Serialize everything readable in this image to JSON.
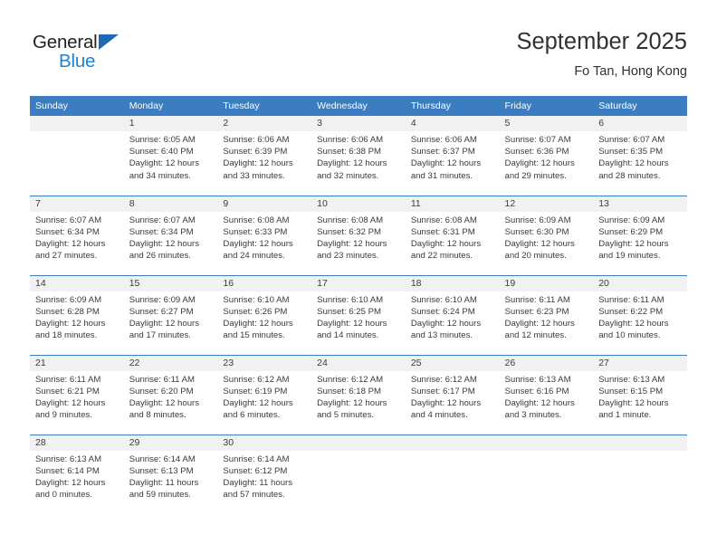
{
  "brand": {
    "name_top": "General",
    "name_bottom": "Blue",
    "triangle_color": "#1c6ab3",
    "text_color": "#1e81d1"
  },
  "header": {
    "title": "September 2025",
    "subtitle": "Fo Tan, Hong Kong"
  },
  "theme": {
    "header_blue": "#3b7dc0",
    "daynum_bg": "#f1f1f1",
    "text": "#3b3b3b"
  },
  "calendar": {
    "weekday_headers": [
      "Sunday",
      "Monday",
      "Tuesday",
      "Wednesday",
      "Thursday",
      "Friday",
      "Saturday"
    ],
    "weeks": [
      [
        {
          "day": "",
          "sunrise": "",
          "sunset": "",
          "daylight": ""
        },
        {
          "day": "1",
          "sunrise": "Sunrise: 6:05 AM",
          "sunset": "Sunset: 6:40 PM",
          "daylight": "Daylight: 12 hours and 34 minutes."
        },
        {
          "day": "2",
          "sunrise": "Sunrise: 6:06 AM",
          "sunset": "Sunset: 6:39 PM",
          "daylight": "Daylight: 12 hours and 33 minutes."
        },
        {
          "day": "3",
          "sunrise": "Sunrise: 6:06 AM",
          "sunset": "Sunset: 6:38 PM",
          "daylight": "Daylight: 12 hours and 32 minutes."
        },
        {
          "day": "4",
          "sunrise": "Sunrise: 6:06 AM",
          "sunset": "Sunset: 6:37 PM",
          "daylight": "Daylight: 12 hours and 31 minutes."
        },
        {
          "day": "5",
          "sunrise": "Sunrise: 6:07 AM",
          "sunset": "Sunset: 6:36 PM",
          "daylight": "Daylight: 12 hours and 29 minutes."
        },
        {
          "day": "6",
          "sunrise": "Sunrise: 6:07 AM",
          "sunset": "Sunset: 6:35 PM",
          "daylight": "Daylight: 12 hours and 28 minutes."
        }
      ],
      [
        {
          "day": "7",
          "sunrise": "Sunrise: 6:07 AM",
          "sunset": "Sunset: 6:34 PM",
          "daylight": "Daylight: 12 hours and 27 minutes."
        },
        {
          "day": "8",
          "sunrise": "Sunrise: 6:07 AM",
          "sunset": "Sunset: 6:34 PM",
          "daylight": "Daylight: 12 hours and 26 minutes."
        },
        {
          "day": "9",
          "sunrise": "Sunrise: 6:08 AM",
          "sunset": "Sunset: 6:33 PM",
          "daylight": "Daylight: 12 hours and 24 minutes."
        },
        {
          "day": "10",
          "sunrise": "Sunrise: 6:08 AM",
          "sunset": "Sunset: 6:32 PM",
          "daylight": "Daylight: 12 hours and 23 minutes."
        },
        {
          "day": "11",
          "sunrise": "Sunrise: 6:08 AM",
          "sunset": "Sunset: 6:31 PM",
          "daylight": "Daylight: 12 hours and 22 minutes."
        },
        {
          "day": "12",
          "sunrise": "Sunrise: 6:09 AM",
          "sunset": "Sunset: 6:30 PM",
          "daylight": "Daylight: 12 hours and 20 minutes."
        },
        {
          "day": "13",
          "sunrise": "Sunrise: 6:09 AM",
          "sunset": "Sunset: 6:29 PM",
          "daylight": "Daylight: 12 hours and 19 minutes."
        }
      ],
      [
        {
          "day": "14",
          "sunrise": "Sunrise: 6:09 AM",
          "sunset": "Sunset: 6:28 PM",
          "daylight": "Daylight: 12 hours and 18 minutes."
        },
        {
          "day": "15",
          "sunrise": "Sunrise: 6:09 AM",
          "sunset": "Sunset: 6:27 PM",
          "daylight": "Daylight: 12 hours and 17 minutes."
        },
        {
          "day": "16",
          "sunrise": "Sunrise: 6:10 AM",
          "sunset": "Sunset: 6:26 PM",
          "daylight": "Daylight: 12 hours and 15 minutes."
        },
        {
          "day": "17",
          "sunrise": "Sunrise: 6:10 AM",
          "sunset": "Sunset: 6:25 PM",
          "daylight": "Daylight: 12 hours and 14 minutes."
        },
        {
          "day": "18",
          "sunrise": "Sunrise: 6:10 AM",
          "sunset": "Sunset: 6:24 PM",
          "daylight": "Daylight: 12 hours and 13 minutes."
        },
        {
          "day": "19",
          "sunrise": "Sunrise: 6:11 AM",
          "sunset": "Sunset: 6:23 PM",
          "daylight": "Daylight: 12 hours and 12 minutes."
        },
        {
          "day": "20",
          "sunrise": "Sunrise: 6:11 AM",
          "sunset": "Sunset: 6:22 PM",
          "daylight": "Daylight: 12 hours and 10 minutes."
        }
      ],
      [
        {
          "day": "21",
          "sunrise": "Sunrise: 6:11 AM",
          "sunset": "Sunset: 6:21 PM",
          "daylight": "Daylight: 12 hours and 9 minutes."
        },
        {
          "day": "22",
          "sunrise": "Sunrise: 6:11 AM",
          "sunset": "Sunset: 6:20 PM",
          "daylight": "Daylight: 12 hours and 8 minutes."
        },
        {
          "day": "23",
          "sunrise": "Sunrise: 6:12 AM",
          "sunset": "Sunset: 6:19 PM",
          "daylight": "Daylight: 12 hours and 6 minutes."
        },
        {
          "day": "24",
          "sunrise": "Sunrise: 6:12 AM",
          "sunset": "Sunset: 6:18 PM",
          "daylight": "Daylight: 12 hours and 5 minutes."
        },
        {
          "day": "25",
          "sunrise": "Sunrise: 6:12 AM",
          "sunset": "Sunset: 6:17 PM",
          "daylight": "Daylight: 12 hours and 4 minutes."
        },
        {
          "day": "26",
          "sunrise": "Sunrise: 6:13 AM",
          "sunset": "Sunset: 6:16 PM",
          "daylight": "Daylight: 12 hours and 3 minutes."
        },
        {
          "day": "27",
          "sunrise": "Sunrise: 6:13 AM",
          "sunset": "Sunset: 6:15 PM",
          "daylight": "Daylight: 12 hours and 1 minute."
        }
      ],
      [
        {
          "day": "28",
          "sunrise": "Sunrise: 6:13 AM",
          "sunset": "Sunset: 6:14 PM",
          "daylight": "Daylight: 12 hours and 0 minutes."
        },
        {
          "day": "29",
          "sunrise": "Sunrise: 6:14 AM",
          "sunset": "Sunset: 6:13 PM",
          "daylight": "Daylight: 11 hours and 59 minutes."
        },
        {
          "day": "30",
          "sunrise": "Sunrise: 6:14 AM",
          "sunset": "Sunset: 6:12 PM",
          "daylight": "Daylight: 11 hours and 57 minutes."
        },
        {
          "day": "",
          "sunrise": "",
          "sunset": "",
          "daylight": ""
        },
        {
          "day": "",
          "sunrise": "",
          "sunset": "",
          "daylight": ""
        },
        {
          "day": "",
          "sunrise": "",
          "sunset": "",
          "daylight": ""
        },
        {
          "day": "",
          "sunrise": "",
          "sunset": "",
          "daylight": ""
        }
      ]
    ]
  }
}
